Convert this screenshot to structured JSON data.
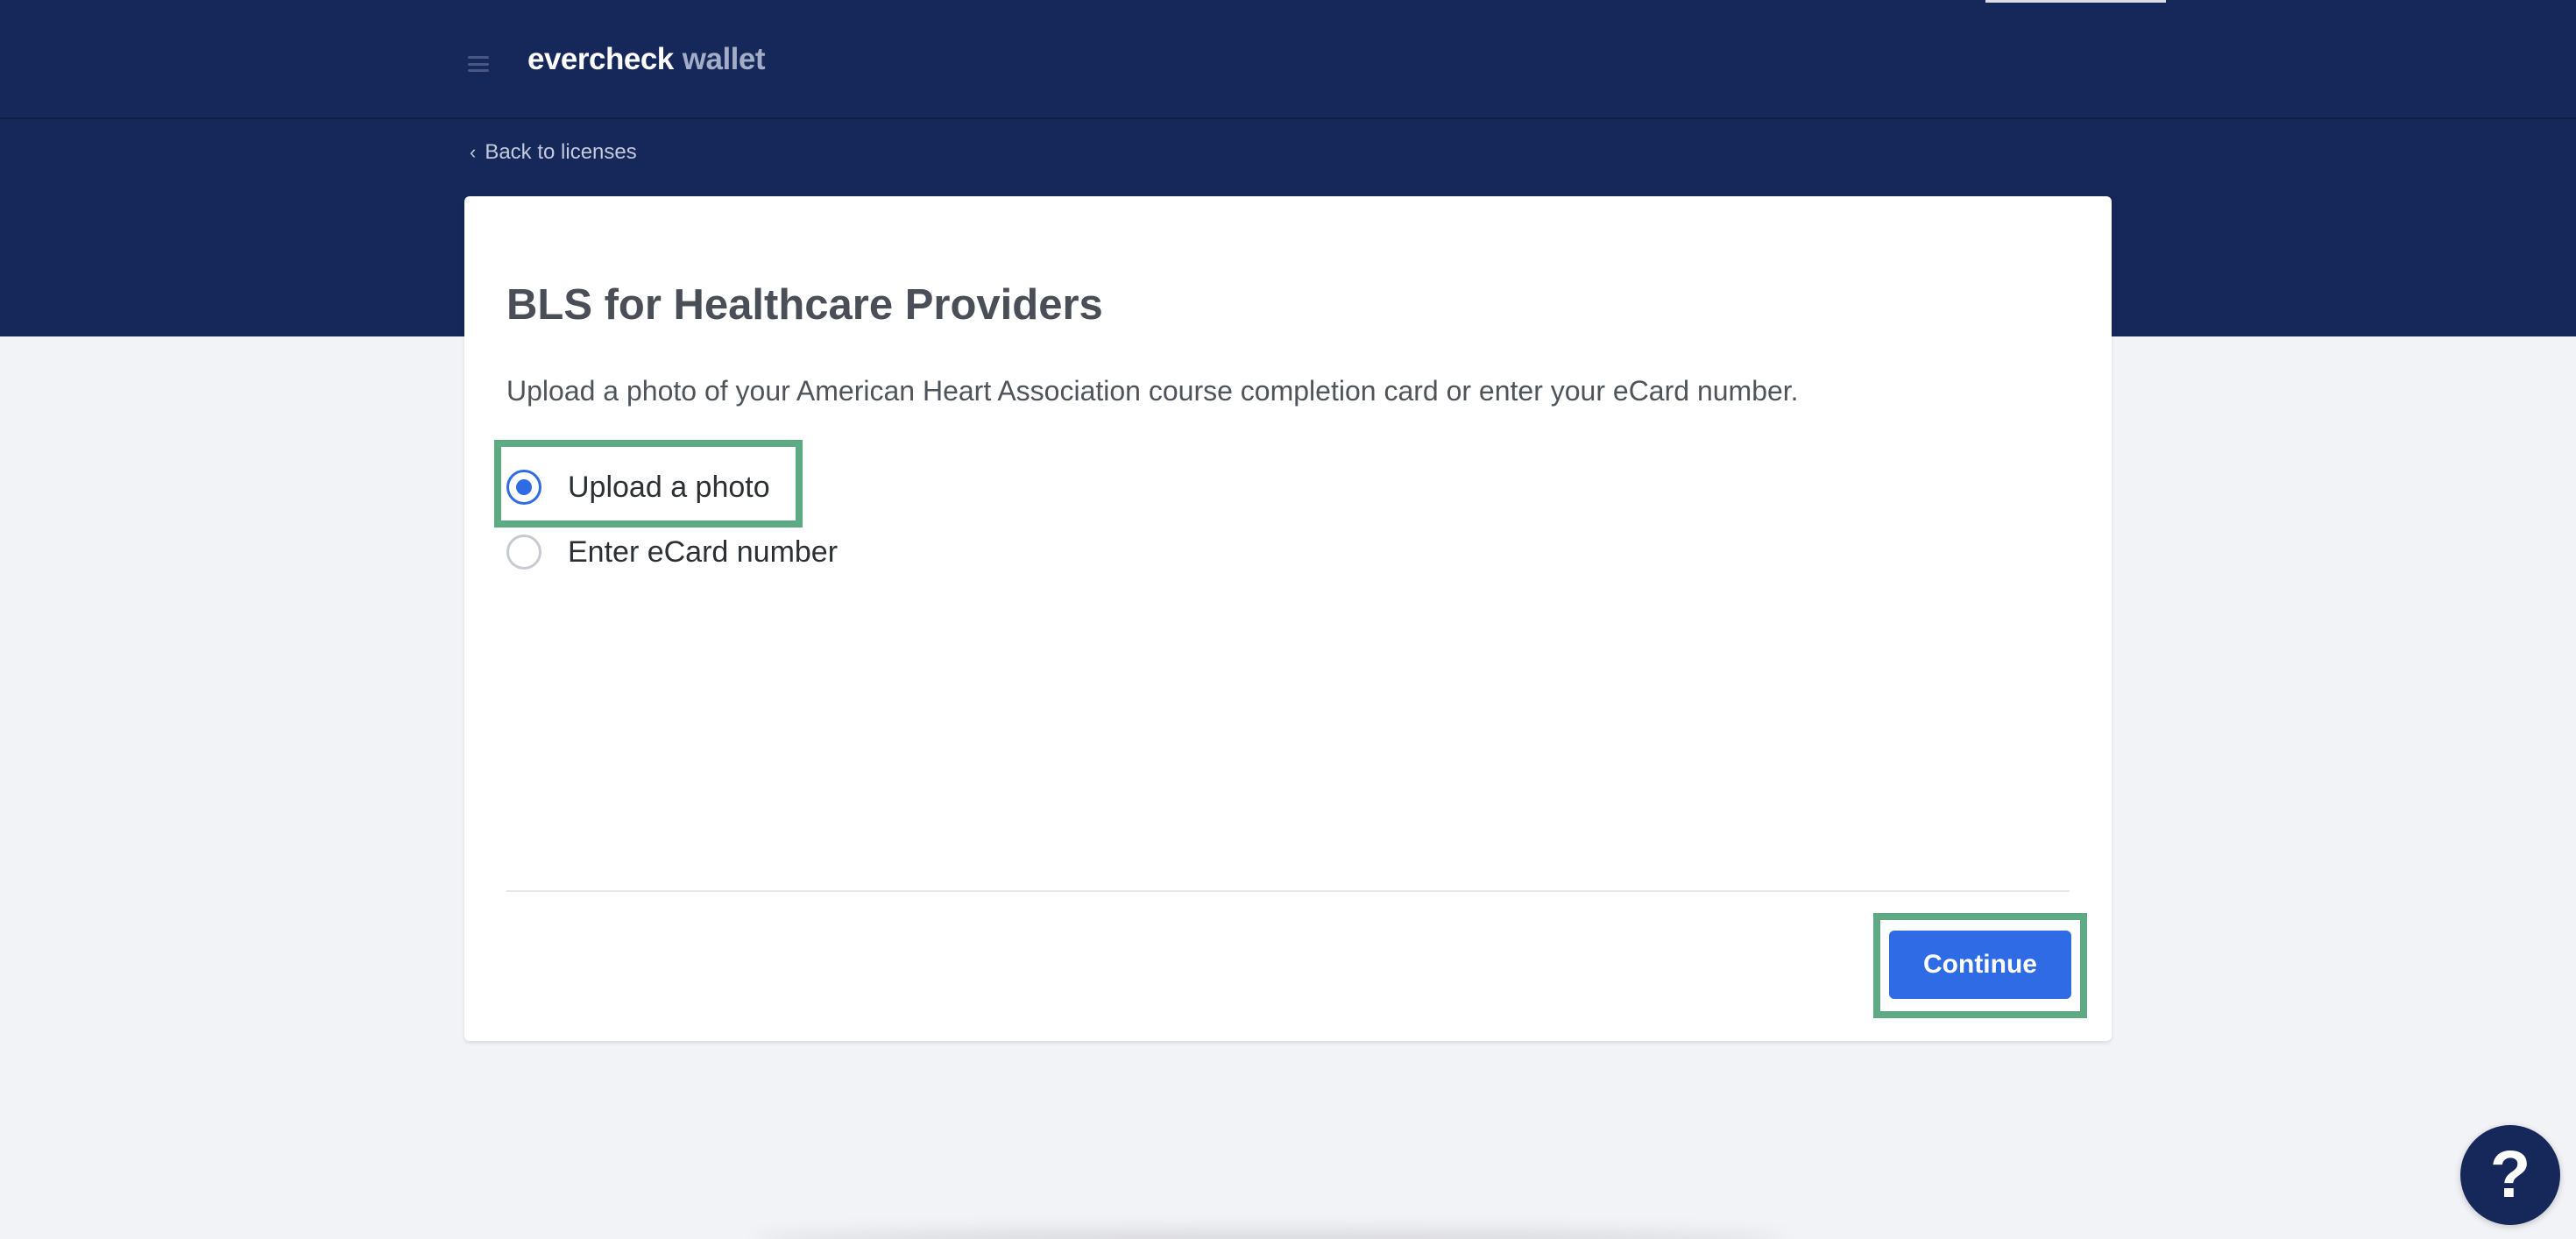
{
  "header": {
    "brand": "evercheck",
    "product": "wallet",
    "menu_icon": "hamburger-menu-icon"
  },
  "nav": {
    "back_label": "Back to licenses",
    "back_icon": "chevron-left-icon"
  },
  "card": {
    "title": "BLS for Healthcare Providers",
    "description": "Upload a photo of your American Heart Association course completion card or enter your eCard number.",
    "options": [
      {
        "label": "Upload a photo",
        "checked": true
      },
      {
        "label": "Enter eCard number",
        "checked": false
      }
    ],
    "continue_label": "Continue"
  },
  "help": {
    "label": "?",
    "icon": "help-question-icon"
  },
  "colors": {
    "header_bg": "#16275a",
    "page_bg": "#f2f3f7",
    "primary": "#2e6be4",
    "highlight": "#5eaa82"
  }
}
